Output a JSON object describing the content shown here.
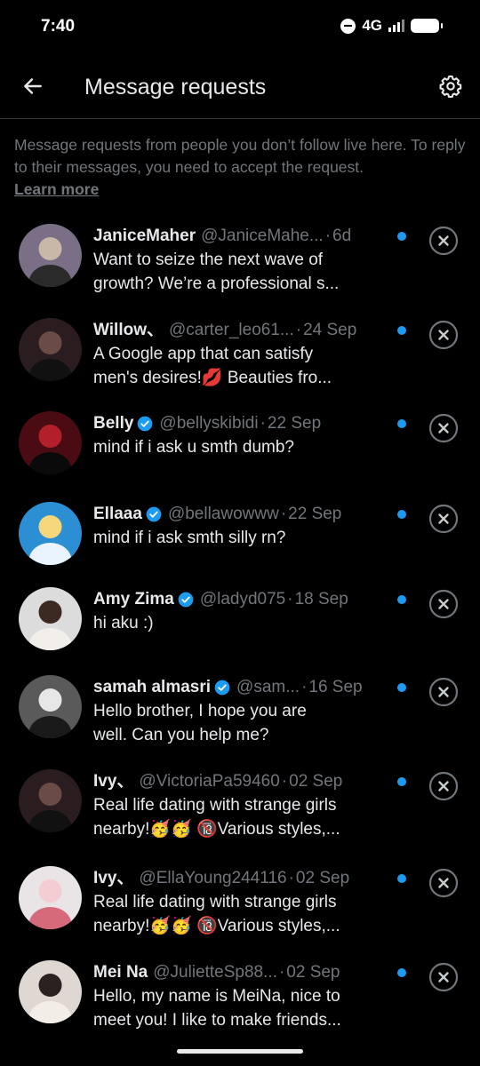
{
  "status_bar": {
    "time": "7:40",
    "network": "4G",
    "icons": [
      "do-not-disturb-icon",
      "signal-icon",
      "battery-icon"
    ]
  },
  "header": {
    "title": "Message requests",
    "back_icon": "back-arrow-icon",
    "settings_icon": "gear-icon"
  },
  "info": {
    "text": "Message requests from people you don’t follow live here. To reply to their messages, you need to accept the request.",
    "link": "Learn more"
  },
  "colors": {
    "background": "#000000",
    "primary_text": "#e7e9ea",
    "secondary_text": "#71767b",
    "accent": "#1d9bf0",
    "divider": "#2f3336"
  },
  "requests": [
    {
      "name": "JaniceMaher",
      "verified": false,
      "handle": "@JaniceMahe...",
      "date": "6d",
      "line1": "Want to seize the next wave of",
      "line2": "growth? We’re a professional s...",
      "unread": true
    },
    {
      "name": "Willow、",
      "verified": false,
      "handle": "@carter_leo61...",
      "date": "24 Sep",
      "line1": "A Google app that can satisfy",
      "line2": "men's desires!💋 Beauties fro...",
      "unread": true
    },
    {
      "name": "Belly",
      "verified": true,
      "handle": "@bellyskibidi",
      "date": "22 Sep",
      "line1": "mind if i ask u smth dumb?",
      "line2": "",
      "unread": true
    },
    {
      "name": "Ellaaa",
      "verified": true,
      "handle": "@bellawowww",
      "date": "22 Sep",
      "line1": "mind if i ask smth silly rn?",
      "line2": "",
      "unread": true
    },
    {
      "name": "Amy Zima",
      "verified": true,
      "handle": "@ladyd075",
      "date": "18 Sep",
      "line1": "hi aku :)",
      "line2": "",
      "unread": true
    },
    {
      "name": "samah almasri",
      "verified": true,
      "handle": "@sam...",
      "date": "16 Sep",
      "line1": "Hello brother, I hope you are",
      "line2": "well. Can you help me?",
      "unread": true
    },
    {
      "name": "Ivy、",
      "verified": false,
      "handle": "@VictoriaPa59460",
      "date": "02 Sep",
      "line1": "Real life dating with strange girls",
      "line2": "nearby!🥳🥳 🔞Various styles,...",
      "unread": true
    },
    {
      "name": "Ivy、",
      "verified": false,
      "handle": "@EllaYoung244116",
      "date": "02 Sep",
      "line1": "Real life dating with strange girls",
      "line2": "nearby!🥳🥳 🔞Various styles,...",
      "unread": true
    },
    {
      "name": "Mei Na",
      "verified": false,
      "handle": "@JulietteSp88...",
      "date": "02 Sep",
      "line1": "Hello, my name is MeiNa, nice to",
      "line2": "meet you! I like to make friends...",
      "unread": true
    }
  ]
}
